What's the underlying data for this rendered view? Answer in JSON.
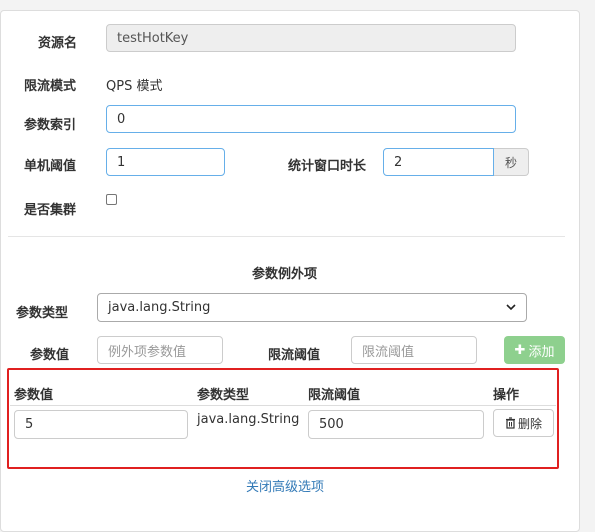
{
  "form": {
    "resource_label": "资源名",
    "resource_value": "testHotKey",
    "mode_label": "限流模式",
    "mode_value": "QPS 模式",
    "param_index_label": "参数索引",
    "param_index_value": "0",
    "threshold_label": "单机阈值",
    "threshold_value": "1",
    "window_label": "统计窗口时长",
    "window_value": "2",
    "window_unit": "秒",
    "cluster_label": "是否集群",
    "cluster_checked": false
  },
  "exceptions": {
    "section_title": "参数例外项",
    "param_type_label": "参数类型",
    "param_type_selected": "java.lang.String",
    "param_value_label": "参数值",
    "param_value_placeholder": "例外项参数值",
    "limit_label": "限流阈值",
    "limit_placeholder": "限流阈值",
    "add_button": "添加"
  },
  "table": {
    "headers": [
      "参数值",
      "参数类型",
      "限流阈值",
      "操作"
    ],
    "rows": [
      {
        "param_value": "5",
        "param_type": "java.lang.String",
        "limit": "500",
        "delete_label": "删除"
      }
    ]
  },
  "footer": {
    "toggle_link": "关闭高级选项"
  },
  "colors": {
    "highlight_border": "#e02020",
    "add_button_bg": "#8ed08e",
    "link": "#337ab7"
  }
}
